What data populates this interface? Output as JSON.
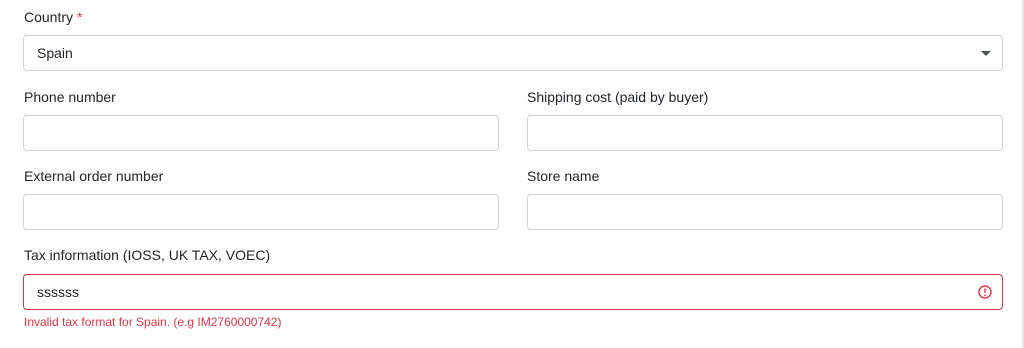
{
  "form": {
    "country": {
      "label": "Country",
      "required_mark": "*",
      "selected": "Spain"
    },
    "phone_number": {
      "label": "Phone number",
      "value": ""
    },
    "shipping_cost": {
      "label": "Shipping cost (paid by buyer)",
      "value": ""
    },
    "external_order_number": {
      "label": "External order number",
      "value": ""
    },
    "store_name": {
      "label": "Store name",
      "value": ""
    },
    "tax_information": {
      "label": "Tax information (IOSS, UK TAX, VOEC)",
      "value": "ssssss",
      "error": "Invalid tax format for Spain. (e.g IM2760000742)",
      "state": "invalid"
    }
  },
  "colors": {
    "error": "#dc3545",
    "border": "#ced4da",
    "text": "#212529"
  },
  "icons": {
    "select_caret": "chevron-down-icon",
    "error_indicator": "error-circle-icon"
  }
}
